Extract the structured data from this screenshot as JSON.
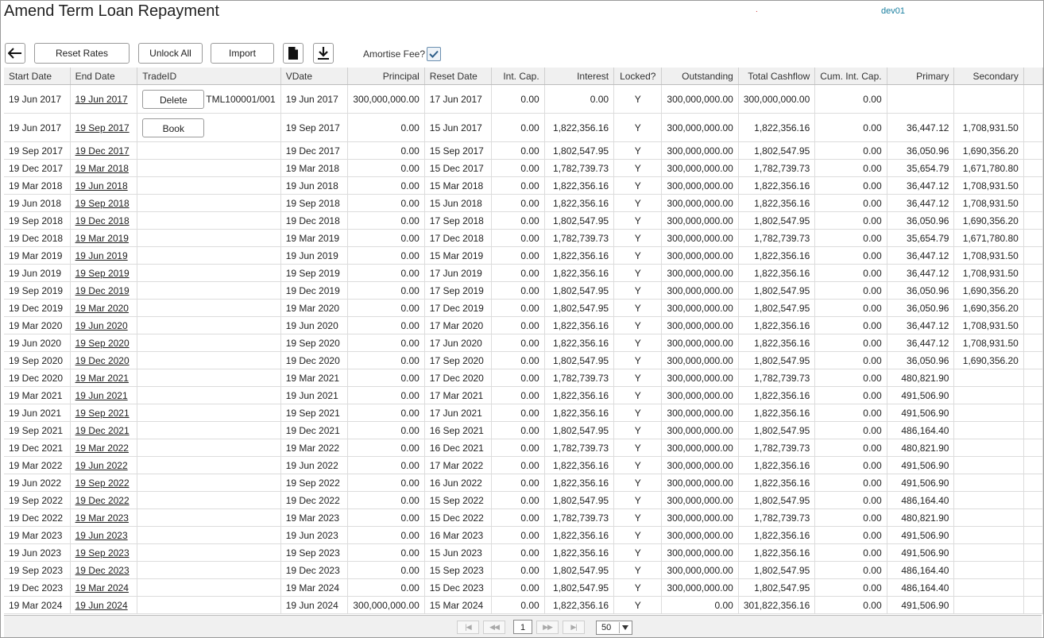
{
  "title": "Amend Term Loan Repayment",
  "user": "dev01",
  "toolbar": {
    "back_icon": "arrow-left-icon",
    "reset_rates": "Reset Rates",
    "unlock_all": "Unlock All",
    "import": "Import",
    "document_icon": "document-icon",
    "download_icon": "download-icon",
    "amortise_fee_label": "Amortise Fee?",
    "amortise_fee_checked": true
  },
  "columns": [
    "Start Date",
    "End Date",
    "TradeID",
    "VDate",
    "Principal",
    "Reset Date",
    "Int. Cap.",
    "Interest",
    "Locked?",
    "Outstanding",
    "Total Cashflow",
    "Cum. Int. Cap.",
    "Primary",
    "Secondary"
  ],
  "rows": [
    [
      "19 Jun 2017",
      "19 Jun 2017",
      "TML100001/001",
      "19 Jun 2017",
      "300,000,000.00",
      "17 Jun 2017",
      "0.00",
      "0.00",
      "Y",
      "300,000,000.00",
      "300,000,000.00",
      "0.00",
      "",
      ""
    ],
    [
      "19 Jun 2017",
      "19 Sep 2017",
      "",
      "19 Sep 2017",
      "0.00",
      "15 Jun 2017",
      "0.00",
      "1,822,356.16",
      "Y",
      "300,000,000.00",
      "1,822,356.16",
      "0.00",
      "36,447.12",
      "1,708,931.50"
    ],
    [
      "19 Sep 2017",
      "19 Dec 2017",
      "",
      "19 Dec 2017",
      "0.00",
      "15 Sep 2017",
      "0.00",
      "1,802,547.95",
      "Y",
      "300,000,000.00",
      "1,802,547.95",
      "0.00",
      "36,050.96",
      "1,690,356.20"
    ],
    [
      "19 Dec 2017",
      "19 Mar 2018",
      "",
      "19 Mar 2018",
      "0.00",
      "15 Dec 2017",
      "0.00",
      "1,782,739.73",
      "Y",
      "300,000,000.00",
      "1,782,739.73",
      "0.00",
      "35,654.79",
      "1,671,780.80"
    ],
    [
      "19 Mar 2018",
      "19 Jun 2018",
      "",
      "19 Jun 2018",
      "0.00",
      "15 Mar 2018",
      "0.00",
      "1,822,356.16",
      "Y",
      "300,000,000.00",
      "1,822,356.16",
      "0.00",
      "36,447.12",
      "1,708,931.50"
    ],
    [
      "19 Jun 2018",
      "19 Sep 2018",
      "",
      "19 Sep 2018",
      "0.00",
      "15 Jun 2018",
      "0.00",
      "1,822,356.16",
      "Y",
      "300,000,000.00",
      "1,822,356.16",
      "0.00",
      "36,447.12",
      "1,708,931.50"
    ],
    [
      "19 Sep 2018",
      "19 Dec 2018",
      "",
      "19 Dec 2018",
      "0.00",
      "17 Sep 2018",
      "0.00",
      "1,802,547.95",
      "Y",
      "300,000,000.00",
      "1,802,547.95",
      "0.00",
      "36,050.96",
      "1,690,356.20"
    ],
    [
      "19 Dec 2018",
      "19 Mar 2019",
      "",
      "19 Mar 2019",
      "0.00",
      "17 Dec 2018",
      "0.00",
      "1,782,739.73",
      "Y",
      "300,000,000.00",
      "1,782,739.73",
      "0.00",
      "35,654.79",
      "1,671,780.80"
    ],
    [
      "19 Mar 2019",
      "19 Jun 2019",
      "",
      "19 Jun 2019",
      "0.00",
      "15 Mar 2019",
      "0.00",
      "1,822,356.16",
      "Y",
      "300,000,000.00",
      "1,822,356.16",
      "0.00",
      "36,447.12",
      "1,708,931.50"
    ],
    [
      "19 Jun 2019",
      "19 Sep 2019",
      "",
      "19 Sep 2019",
      "0.00",
      "17 Jun 2019",
      "0.00",
      "1,822,356.16",
      "Y",
      "300,000,000.00",
      "1,822,356.16",
      "0.00",
      "36,447.12",
      "1,708,931.50"
    ],
    [
      "19 Sep 2019",
      "19 Dec 2019",
      "",
      "19 Dec 2019",
      "0.00",
      "17 Sep 2019",
      "0.00",
      "1,802,547.95",
      "Y",
      "300,000,000.00",
      "1,802,547.95",
      "0.00",
      "36,050.96",
      "1,690,356.20"
    ],
    [
      "19 Dec 2019",
      "19 Mar 2020",
      "",
      "19 Mar 2020",
      "0.00",
      "17 Dec 2019",
      "0.00",
      "1,802,547.95",
      "Y",
      "300,000,000.00",
      "1,802,547.95",
      "0.00",
      "36,050.96",
      "1,690,356.20"
    ],
    [
      "19 Mar 2020",
      "19 Jun 2020",
      "",
      "19 Jun 2020",
      "0.00",
      "17 Mar 2020",
      "0.00",
      "1,822,356.16",
      "Y",
      "300,000,000.00",
      "1,822,356.16",
      "0.00",
      "36,447.12",
      "1,708,931.50"
    ],
    [
      "19 Jun 2020",
      "19 Sep 2020",
      "",
      "19 Sep 2020",
      "0.00",
      "17 Jun 2020",
      "0.00",
      "1,822,356.16",
      "Y",
      "300,000,000.00",
      "1,822,356.16",
      "0.00",
      "36,447.12",
      "1,708,931.50"
    ],
    [
      "19 Sep 2020",
      "19 Dec 2020",
      "",
      "19 Dec 2020",
      "0.00",
      "17 Sep 2020",
      "0.00",
      "1,802,547.95",
      "Y",
      "300,000,000.00",
      "1,802,547.95",
      "0.00",
      "36,050.96",
      "1,690,356.20"
    ],
    [
      "19 Dec 2020",
      "19 Mar 2021",
      "",
      "19 Mar 2021",
      "0.00",
      "17 Dec 2020",
      "0.00",
      "1,782,739.73",
      "Y",
      "300,000,000.00",
      "1,782,739.73",
      "0.00",
      "480,821.90",
      ""
    ],
    [
      "19 Mar 2021",
      "19 Jun 2021",
      "",
      "19 Jun 2021",
      "0.00",
      "17 Mar 2021",
      "0.00",
      "1,822,356.16",
      "Y",
      "300,000,000.00",
      "1,822,356.16",
      "0.00",
      "491,506.90",
      ""
    ],
    [
      "19 Jun 2021",
      "19 Sep 2021",
      "",
      "19 Sep 2021",
      "0.00",
      "17 Jun 2021",
      "0.00",
      "1,822,356.16",
      "Y",
      "300,000,000.00",
      "1,822,356.16",
      "0.00",
      "491,506.90",
      ""
    ],
    [
      "19 Sep 2021",
      "19 Dec 2021",
      "",
      "19 Dec 2021",
      "0.00",
      "16 Sep 2021",
      "0.00",
      "1,802,547.95",
      "Y",
      "300,000,000.00",
      "1,802,547.95",
      "0.00",
      "486,164.40",
      ""
    ],
    [
      "19 Dec 2021",
      "19 Mar 2022",
      "",
      "19 Mar 2022",
      "0.00",
      "16 Dec 2021",
      "0.00",
      "1,782,739.73",
      "Y",
      "300,000,000.00",
      "1,782,739.73",
      "0.00",
      "480,821.90",
      ""
    ],
    [
      "19 Mar 2022",
      "19 Jun 2022",
      "",
      "19 Jun 2022",
      "0.00",
      "17 Mar 2022",
      "0.00",
      "1,822,356.16",
      "Y",
      "300,000,000.00",
      "1,822,356.16",
      "0.00",
      "491,506.90",
      ""
    ],
    [
      "19 Jun 2022",
      "19 Sep 2022",
      "",
      "19 Sep 2022",
      "0.00",
      "16 Jun 2022",
      "0.00",
      "1,822,356.16",
      "Y",
      "300,000,000.00",
      "1,822,356.16",
      "0.00",
      "491,506.90",
      ""
    ],
    [
      "19 Sep 2022",
      "19 Dec 2022",
      "",
      "19 Dec 2022",
      "0.00",
      "15 Sep 2022",
      "0.00",
      "1,802,547.95",
      "Y",
      "300,000,000.00",
      "1,802,547.95",
      "0.00",
      "486,164.40",
      ""
    ],
    [
      "19 Dec 2022",
      "19 Mar 2023",
      "",
      "19 Mar 2023",
      "0.00",
      "15 Dec 2022",
      "0.00",
      "1,782,739.73",
      "Y",
      "300,000,000.00",
      "1,782,739.73",
      "0.00",
      "480,821.90",
      ""
    ],
    [
      "19 Mar 2023",
      "19 Jun 2023",
      "",
      "19 Jun 2023",
      "0.00",
      "16 Mar 2023",
      "0.00",
      "1,822,356.16",
      "Y",
      "300,000,000.00",
      "1,822,356.16",
      "0.00",
      "491,506.90",
      ""
    ],
    [
      "19 Jun 2023",
      "19 Sep 2023",
      "",
      "19 Sep 2023",
      "0.00",
      "15 Jun 2023",
      "0.00",
      "1,822,356.16",
      "Y",
      "300,000,000.00",
      "1,822,356.16",
      "0.00",
      "491,506.90",
      ""
    ],
    [
      "19 Sep 2023",
      "19 Dec 2023",
      "",
      "19 Dec 2023",
      "0.00",
      "15 Sep 2023",
      "0.00",
      "1,802,547.95",
      "Y",
      "300,000,000.00",
      "1,802,547.95",
      "0.00",
      "486,164.40",
      ""
    ],
    [
      "19 Dec 2023",
      "19 Mar 2024",
      "",
      "19 Mar 2024",
      "0.00",
      "15 Dec 2023",
      "0.00",
      "1,802,547.95",
      "Y",
      "300,000,000.00",
      "1,802,547.95",
      "0.00",
      "486,164.40",
      ""
    ],
    [
      "19 Mar 2024",
      "19 Jun 2024",
      "",
      "19 Jun 2024",
      "300,000,000.00",
      "15 Mar 2024",
      "0.00",
      "1,822,356.16",
      "Y",
      "0.00",
      "301,822,356.16",
      "0.00",
      "491,506.90",
      ""
    ]
  ],
  "row_actions": {
    "delete": "Delete",
    "book": "Book"
  },
  "pager": {
    "first": "|◀",
    "prev": "◀◀",
    "next": "▶▶",
    "last": "▶|",
    "page": "1",
    "page_size": "50"
  }
}
